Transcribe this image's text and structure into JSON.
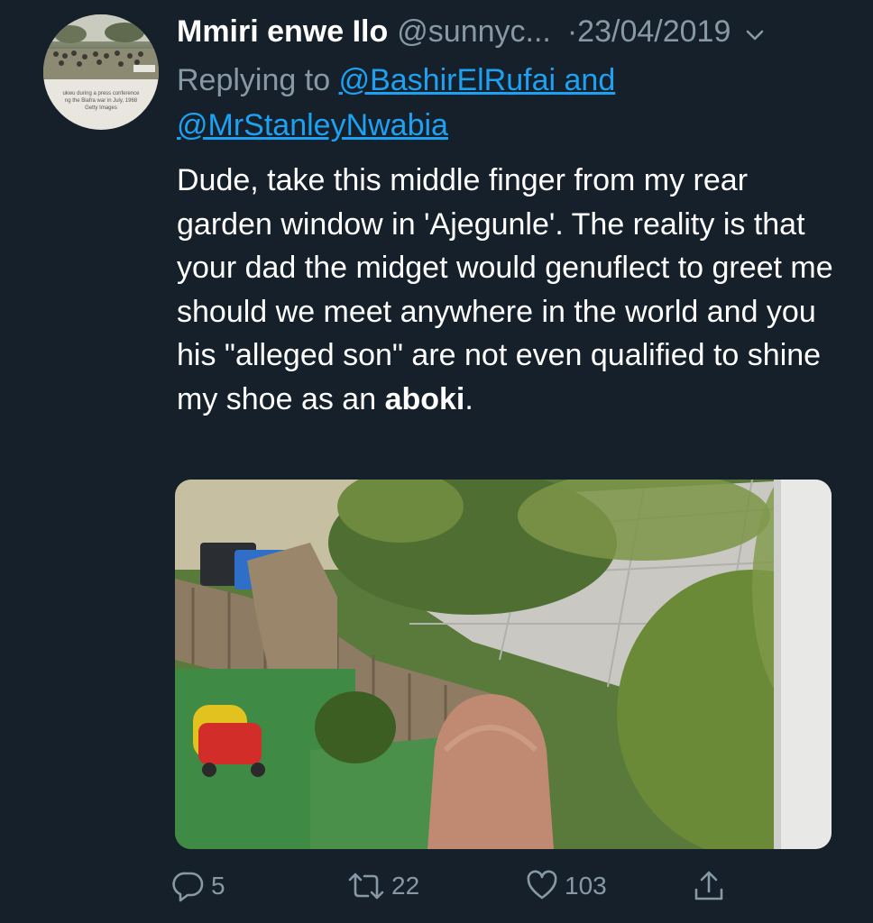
{
  "author": {
    "display_name": "Mmiri enwe Ilo",
    "handle": "@sunnyc...",
    "avatar_caption_line1": "ukwu during a press conference",
    "avatar_caption_line2": "ng the Biafra war in July, 1968",
    "avatar_caption_line3": "Getty Images"
  },
  "tweet": {
    "date": "·23/04/2019",
    "replying_to_prefix": "Replying to",
    "mention_1": "@BashirElRufai",
    "mention_joiner": "and",
    "mention_2": "@MrStanleyNwabia",
    "text_main": "Dude, take this middle finger from my rear garden window in 'Ajegunle'. The reality is that your dad the midget would genuflect to greet me should we meet anywhere in the world and you his \"alleged son\"  are not even qualified to shine my shoe as an ",
    "text_bold": "aboki",
    "text_end": "."
  },
  "actions": {
    "reply_count": "5",
    "retweet_count": "22",
    "like_count": "103"
  },
  "icons": {
    "reply": "reply-icon",
    "retweet": "retweet-icon",
    "like": "heart-icon",
    "share": "share-icon",
    "menu": "chevron-down-icon"
  },
  "colors": {
    "background": "#15202b",
    "secondary_text": "#8899a6",
    "link": "#1da1f2"
  }
}
